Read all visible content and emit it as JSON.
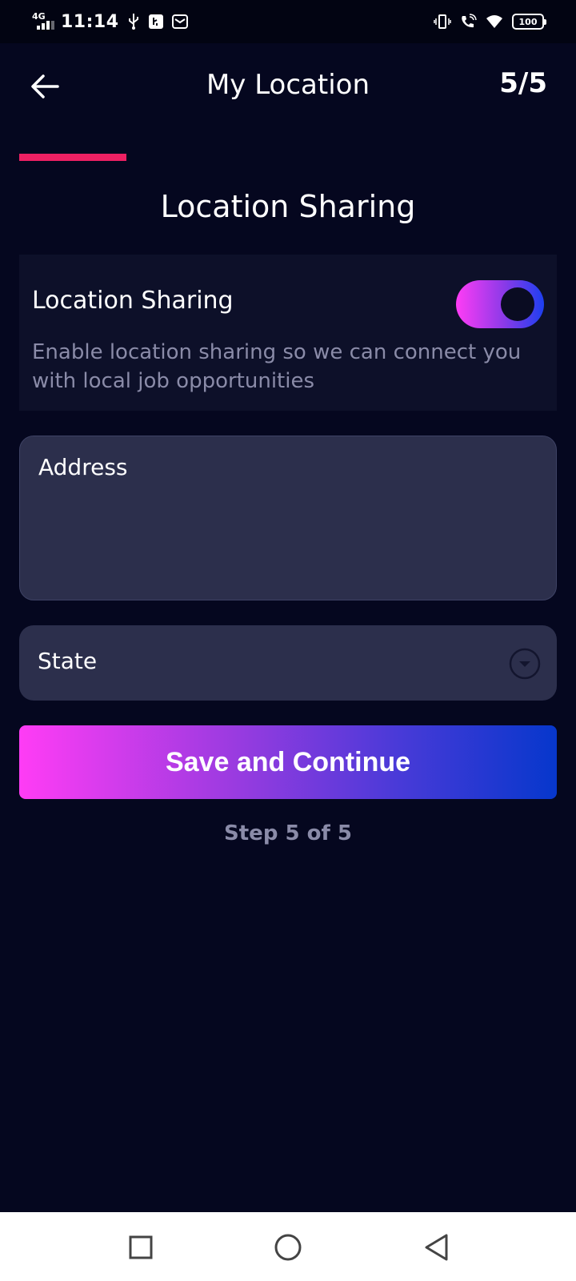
{
  "status_bar": {
    "network": "4G",
    "time": "11:14",
    "battery": "100"
  },
  "header": {
    "title": "My Location",
    "step_count": "5/5"
  },
  "progress": {
    "fraction": 0.2
  },
  "section_title": "Location Sharing",
  "location_sharing": {
    "label": "Location Sharing",
    "description": "Enable location sharing so we can connect you with local job opportunities",
    "enabled": true
  },
  "form": {
    "address_placeholder": "Address",
    "state_placeholder": "State"
  },
  "actions": {
    "save_label": "Save and Continue"
  },
  "step_text": "Step 5 of 5",
  "colors": {
    "background": "#05071f",
    "accent_progress": "#ee2063",
    "gradient_start": "#ff3cf5",
    "gradient_end": "#0637cc"
  }
}
